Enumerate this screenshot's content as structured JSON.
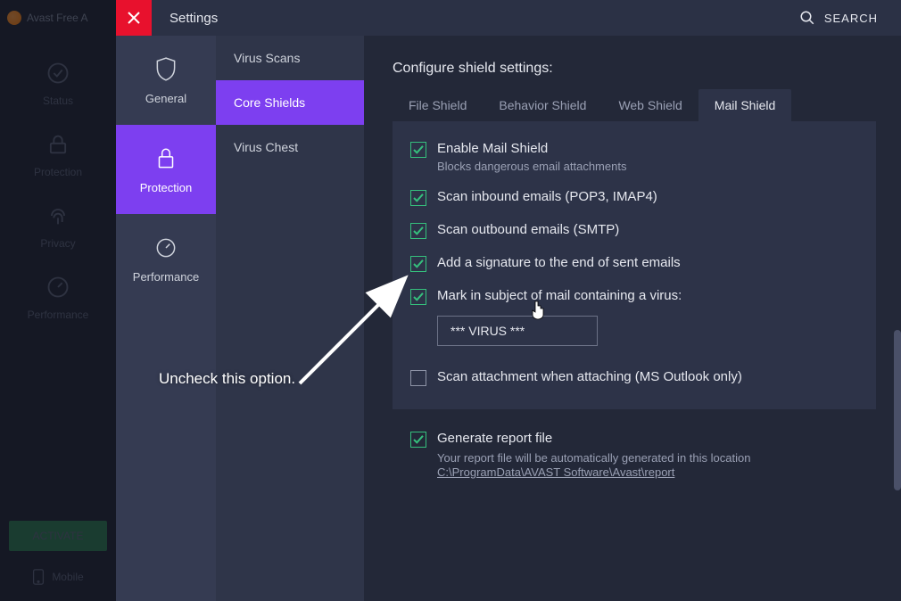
{
  "brand": "Avast Free A",
  "topbar": {
    "title": "Settings",
    "search": "SEARCH"
  },
  "leftnav": {
    "status": "Status",
    "protection": "Protection",
    "privacy": "Privacy",
    "performance": "Performance",
    "activate": "ACTIVATE",
    "mobile": "Mobile"
  },
  "categories": {
    "general": "General",
    "protection": "Protection",
    "performance": "Performance"
  },
  "subitems": {
    "virus_scans": "Virus Scans",
    "core_shields": "Core Shields",
    "virus_chest": "Virus Chest"
  },
  "heading": "Configure shield settings:",
  "tabs": {
    "file": "File Shield",
    "behavior": "Behavior Shield",
    "web": "Web Shield",
    "mail": "Mail Shield"
  },
  "options": {
    "enable": {
      "label": "Enable Mail Shield",
      "sub": "Blocks dangerous email attachments",
      "checked": true
    },
    "inbound": {
      "label": "Scan inbound emails (POP3, IMAP4)",
      "checked": true
    },
    "outbound": {
      "label": "Scan outbound emails (SMTP)",
      "checked": true
    },
    "signature": {
      "label": "Add a signature to the end of sent emails",
      "checked": true
    },
    "marksubject": {
      "label": "Mark in subject of mail containing a virus:",
      "checked": true,
      "value": "*** VIRUS ***"
    },
    "scanattach": {
      "label": "Scan attachment when attaching (MS Outlook only)",
      "checked": false
    }
  },
  "report": {
    "label": "Generate report file",
    "sub": "Your report file will be automatically generated in this location",
    "path": "C:\\ProgramData\\AVAST Software\\Avast\\report",
    "checked": true
  },
  "annotation": "Uncheck this option."
}
